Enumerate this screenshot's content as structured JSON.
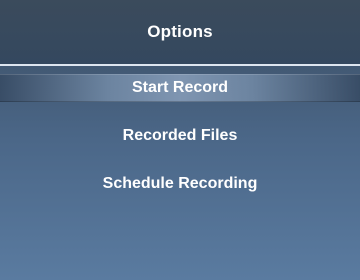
{
  "header": {
    "title": "Options"
  },
  "menu": {
    "items": [
      {
        "label": "Start Record",
        "selected": true
      },
      {
        "label": "Recorded Files",
        "selected": false
      },
      {
        "label": "Schedule Recording",
        "selected": false
      }
    ]
  }
}
